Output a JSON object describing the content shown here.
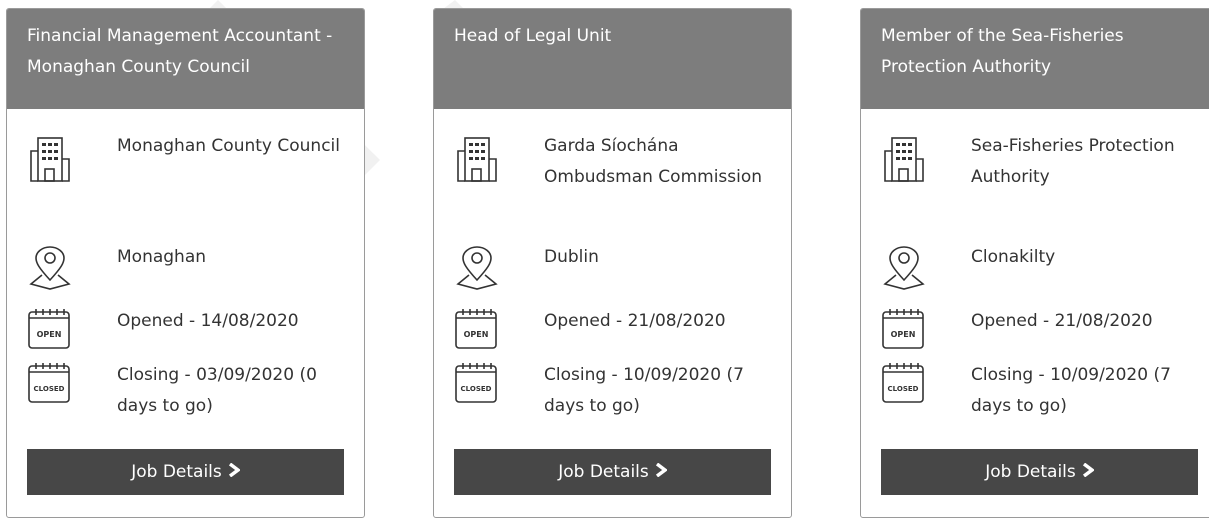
{
  "jobs": [
    {
      "title": "Financial Management Accountant - Monaghan County Council",
      "organisation": "Monaghan County Council",
      "location": "Monaghan",
      "opened": "Opened - 14/08/2020",
      "closing": "Closing - 03/09/2020 (0 days to go)",
      "button_label": "Job Details"
    },
    {
      "title": "Head of Legal Unit",
      "organisation": "Garda Síochána Ombudsman Commission",
      "location": "Dublin",
      "opened": "Opened - 21/08/2020",
      "closing": "Closing - 10/09/2020 (7 days to go)",
      "button_label": "Job Details"
    },
    {
      "title": "Member of the Sea-Fisheries Protection Authority",
      "organisation": "Sea-Fisheries Protection Authority",
      "location": "Clonakilty",
      "opened": "Opened - 21/08/2020",
      "closing": "Closing - 10/09/2020 (7 days to go)",
      "button_label": "Job Details"
    }
  ],
  "icons": {
    "organisation": "building-icon",
    "location": "map-pin-icon",
    "opened": "calendar-open-icon",
    "closing": "calendar-closed-icon",
    "button": "chevron-right-icon"
  },
  "calendar_labels": {
    "open": "OPEN",
    "closed": "CLOSED"
  },
  "colors": {
    "header_bg": "#7d7d7d",
    "button_bg": "#474747",
    "card_border": "#9a9a9a",
    "text": "#333333"
  }
}
